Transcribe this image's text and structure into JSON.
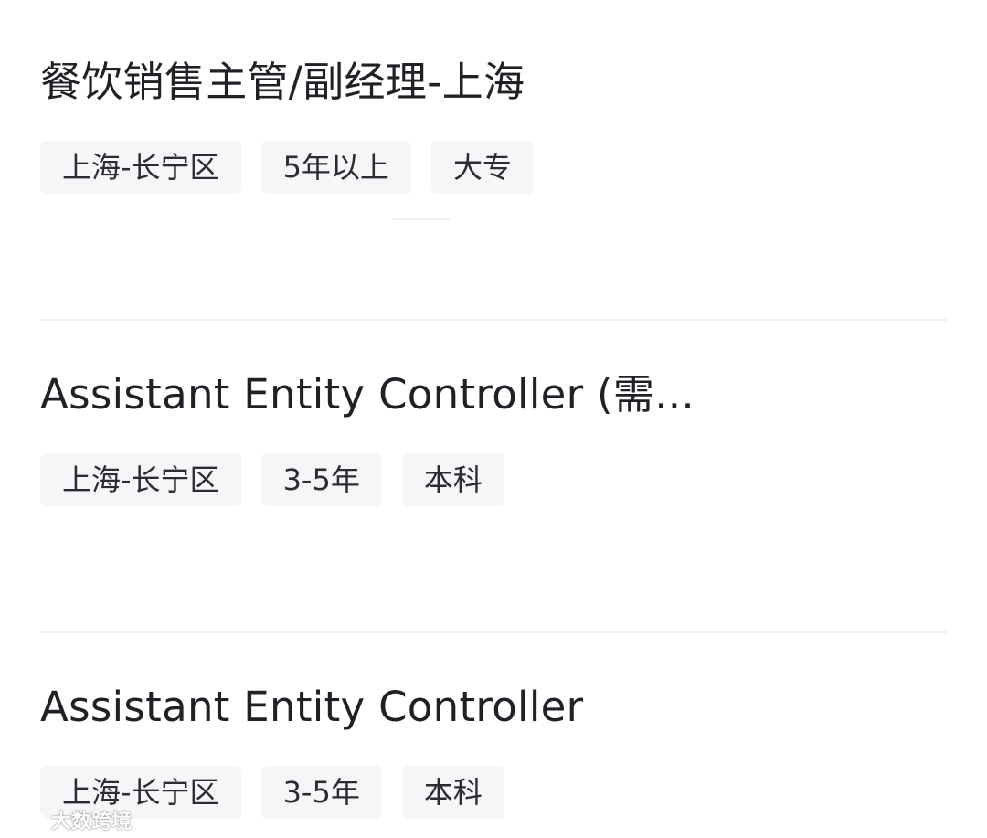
{
  "jobs": [
    {
      "title": "餐饮销售主管/副经理-上海",
      "location": "上海-长宁区",
      "experience": "5年以上",
      "education": "大专"
    },
    {
      "title": "Assistant Entity Controller (需...",
      "location": "上海-长宁区",
      "experience": "3-5年",
      "education": "本科"
    },
    {
      "title": "Assistant Entity Controller",
      "location": "上海-长宁区",
      "experience": "3-5年",
      "education": "本科"
    }
  ],
  "watermark": {
    "text": "大数跨境",
    "icon": "brand-logo-icon"
  },
  "colors": {
    "title_text": "#1f2126",
    "tag_background": "#f5f6f8",
    "tag_text": "#2a2c31",
    "divider": "#eceef1"
  }
}
